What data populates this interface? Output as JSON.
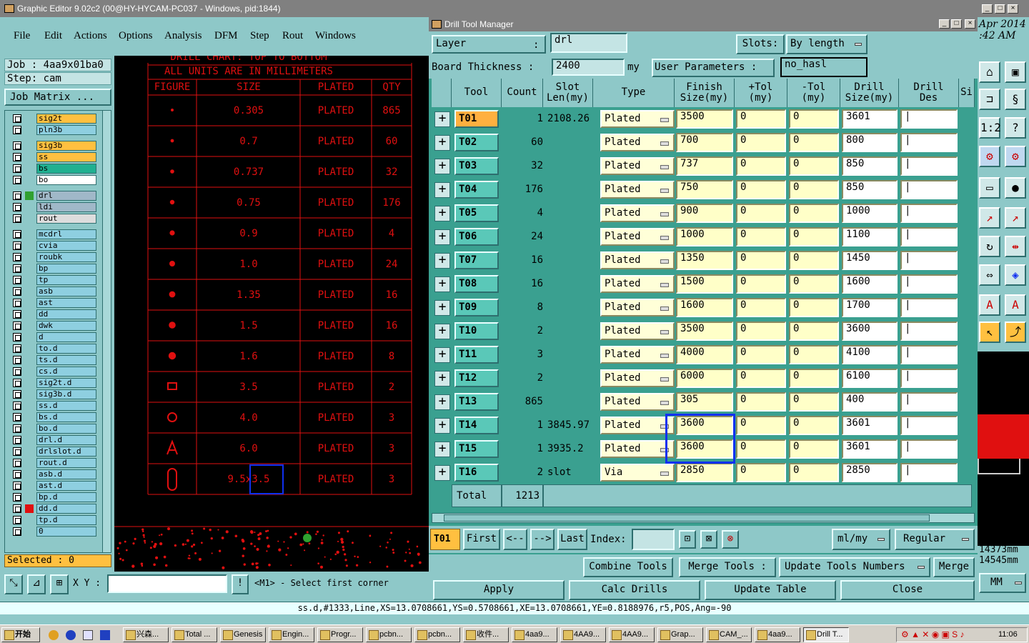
{
  "main_window": {
    "title": "Graphic Editor 9.02c2 (00@HY-HYCAM-PC037 - Windows, pid:1844)"
  },
  "menu": [
    "File",
    "Edit",
    "Actions",
    "Options",
    "Analysis",
    "DFM",
    "Step",
    "Rout",
    "Windows"
  ],
  "job": {
    "job_label": "Job : 4aa9x01ba0",
    "step_label": "Step: cam",
    "matrix_button": "Job Matrix ..."
  },
  "layers": [
    {
      "name": "sig2t",
      "color": "#ffc040"
    },
    {
      "name": "pln3b",
      "color": "#8ecfe0"
    },
    {
      "name": "sig3b",
      "color": "#ffc040"
    },
    {
      "name": "ss",
      "color": "#ffc040"
    },
    {
      "name": "bs",
      "color": "#20b090"
    },
    {
      "name": "bo",
      "color": "#ffffff"
    },
    {
      "name": "drl",
      "color": "#a0b8c8"
    },
    {
      "name": "ldi",
      "color": "#a0b8c8"
    },
    {
      "name": "rout",
      "color": "#dddddd"
    },
    {
      "name": "mcdrl",
      "color": "#8ecfe0"
    },
    {
      "name": "cvia",
      "color": "#8ecfe0"
    },
    {
      "name": "roubk",
      "color": "#8ecfe0"
    },
    {
      "name": "bp",
      "color": "#8ecfe0"
    },
    {
      "name": "tp",
      "color": "#8ecfe0"
    },
    {
      "name": "asb",
      "color": "#8ecfe0"
    },
    {
      "name": "ast",
      "color": "#8ecfe0"
    },
    {
      "name": "dd",
      "color": "#8ecfe0"
    },
    {
      "name": "dwk",
      "color": "#8ecfe0"
    },
    {
      "name": "d",
      "color": "#8ecfe0"
    },
    {
      "name": "to.d",
      "color": "#8ecfe0"
    },
    {
      "name": "ts.d",
      "color": "#8ecfe0"
    },
    {
      "name": "cs.d",
      "color": "#8ecfe0"
    },
    {
      "name": "sig2t.d",
      "color": "#8ecfe0"
    },
    {
      "name": "sig3b.d",
      "color": "#8ecfe0"
    },
    {
      "name": "ss.d",
      "color": "#8ecfe0"
    },
    {
      "name": "bs.d",
      "color": "#8ecfe0"
    },
    {
      "name": "bo.d",
      "color": "#8ecfe0"
    },
    {
      "name": "drl.d",
      "color": "#8ecfe0"
    },
    {
      "name": "drlslot.d",
      "color": "#8ecfe0"
    },
    {
      "name": "rout.d",
      "color": "#8ecfe0"
    },
    {
      "name": "asb.d",
      "color": "#8ecfe0"
    },
    {
      "name": "ast.d",
      "color": "#8ecfe0"
    },
    {
      "name": "bp.d",
      "color": "#8ecfe0"
    },
    {
      "name": "dd.d",
      "color": "#8ecfe0"
    },
    {
      "name": "tp.d",
      "color": "#8ecfe0"
    },
    {
      "name": "0",
      "color": "#8ecfe0"
    }
  ],
  "selected_label": "Selected : 0",
  "xy_label": "X Y :",
  "prompt": "<M1> - Select first corner",
  "drill_chart": {
    "header1": "DRILL CHART: TOP TO BOTTOM",
    "header2": "ALL UNITS ARE IN MILLIMETERS",
    "columns": [
      "FIGURE",
      "SIZE",
      "PLATED",
      "QTY"
    ],
    "rows": [
      {
        "size": "0.305",
        "plated": "PLATED",
        "qty": "865"
      },
      {
        "size": "0.7",
        "plated": "PLATED",
        "qty": "60"
      },
      {
        "size": "0.737",
        "plated": "PLATED",
        "qty": "32"
      },
      {
        "size": "0.75",
        "plated": "PLATED",
        "qty": "176"
      },
      {
        "size": "0.9",
        "plated": "PLATED",
        "qty": "4"
      },
      {
        "size": "1.0",
        "plated": "PLATED",
        "qty": "24"
      },
      {
        "size": "1.35",
        "plated": "PLATED",
        "qty": "16"
      },
      {
        "size": "1.5",
        "plated": "PLATED",
        "qty": "16"
      },
      {
        "size": "1.6",
        "plated": "PLATED",
        "qty": "8"
      },
      {
        "size": "3.5",
        "plated": "PLATED",
        "qty": "2"
      },
      {
        "size": "4.0",
        "plated": "PLATED",
        "qty": "3"
      },
      {
        "size": "6.0",
        "plated": "PLATED",
        "qty": "3"
      },
      {
        "size": "9.5x3.5",
        "plated": "PLATED",
        "qty": "3"
      }
    ]
  },
  "dtm": {
    "title": "Drill Tool Manager",
    "layer_label": "Layer",
    "layer_colon": ":",
    "layer_value": "drl",
    "slots_label": "Slots:",
    "slots_value": "By length",
    "thickness_label": "Board Thickness :",
    "thickness_value": "2400",
    "thickness_unit": "my",
    "user_params_label": "User Parameters :",
    "user_params_value": "no_hasl",
    "columns": {
      "tool": "Tool",
      "count": "Count",
      "slot1": "Slot",
      "slot2": "Len(my)",
      "type": "Type",
      "finish1": "Finish",
      "finish2": "Size(my)",
      "ptol1": "+Tol",
      "ptol2": "(my)",
      "mtol1": "-Tol",
      "mtol2": "(my)",
      "drill1": "Drill",
      "drill2": "Size(my)",
      "des1": "Drill",
      "des2": "Des",
      "si": "Si"
    },
    "tools": [
      {
        "tool": "T01",
        "count": "1",
        "slot": "2108.26",
        "type": "Plated",
        "finish": "3500",
        "ptol": "0",
        "mtol": "0",
        "drill": "3601"
      },
      {
        "tool": "T02",
        "count": "60",
        "slot": "",
        "type": "Plated",
        "finish": "700",
        "ptol": "0",
        "mtol": "0",
        "drill": "800"
      },
      {
        "tool": "T03",
        "count": "32",
        "slot": "",
        "type": "Plated",
        "finish": "737",
        "ptol": "0",
        "mtol": "0",
        "drill": "850"
      },
      {
        "tool": "T04",
        "count": "176",
        "slot": "",
        "type": "Plated",
        "finish": "750",
        "ptol": "0",
        "mtol": "0",
        "drill": "850"
      },
      {
        "tool": "T05",
        "count": "4",
        "slot": "",
        "type": "Plated",
        "finish": "900",
        "ptol": "0",
        "mtol": "0",
        "drill": "1000"
      },
      {
        "tool": "T06",
        "count": "24",
        "slot": "",
        "type": "Plated",
        "finish": "1000",
        "ptol": "0",
        "mtol": "0",
        "drill": "1100"
      },
      {
        "tool": "T07",
        "count": "16",
        "slot": "",
        "type": "Plated",
        "finish": "1350",
        "ptol": "0",
        "mtol": "0",
        "drill": "1450"
      },
      {
        "tool": "T08",
        "count": "16",
        "slot": "",
        "type": "Plated",
        "finish": "1500",
        "ptol": "0",
        "mtol": "0",
        "drill": "1600"
      },
      {
        "tool": "T09",
        "count": "8",
        "slot": "",
        "type": "Plated",
        "finish": "1600",
        "ptol": "0",
        "mtol": "0",
        "drill": "1700"
      },
      {
        "tool": "T10",
        "count": "2",
        "slot": "",
        "type": "Plated",
        "finish": "3500",
        "ptol": "0",
        "mtol": "0",
        "drill": "3600"
      },
      {
        "tool": "T11",
        "count": "3",
        "slot": "",
        "type": "Plated",
        "finish": "4000",
        "ptol": "0",
        "mtol": "0",
        "drill": "4100"
      },
      {
        "tool": "T12",
        "count": "2",
        "slot": "",
        "type": "Plated",
        "finish": "6000",
        "ptol": "0",
        "mtol": "0",
        "drill": "6100"
      },
      {
        "tool": "T13",
        "count": "865",
        "slot": "",
        "type": "Plated",
        "finish": "305",
        "ptol": "0",
        "mtol": "0",
        "drill": "400"
      },
      {
        "tool": "T14",
        "count": "1",
        "slot": "3845.97",
        "type": "Plated",
        "finish": "3600",
        "ptol": "0",
        "mtol": "0",
        "drill": "3601"
      },
      {
        "tool": "T15",
        "count": "1",
        "slot": "3935.2",
        "type": "Plated",
        "finish": "3600",
        "ptol": "0",
        "mtol": "0",
        "drill": "3601"
      },
      {
        "tool": "T16",
        "count": "2",
        "slot": "slot",
        "type": "Via",
        "finish": "2850",
        "ptol": "0",
        "mtol": "0",
        "drill": "2850"
      }
    ],
    "total_label": "Total",
    "total_value": "1213",
    "nav": {
      "current": "T01",
      "first": "First",
      "prev": "<--",
      "next": "-->",
      "last": "Last",
      "index": "Index:",
      "units": "ml/my",
      "mode": "Regular"
    },
    "actions": {
      "combine": "Combine Tools",
      "merge_tools": "Merge Tools :",
      "update_numbers": "Update Tools Numbers",
      "merge": "Merge"
    },
    "bottom": {
      "apply": "Apply",
      "calc": "Calc Drills",
      "update_table": "Update Table",
      "close": "Close"
    }
  },
  "right_panel": {
    "date1": "Apr 2014",
    "date2": ":42 AM",
    "coord1": "14373mm",
    "coord2": "14545mm",
    "units": "MM"
  },
  "status_line": "ss.d,#1333,Line,XS=13.0708661,YS=0.5708661,XE=13.0708661,YE=0.8188976,r5,POS,Ang=-90",
  "taskbar": {
    "start": "开始",
    "tasks": [
      "兴森...",
      "Total ...",
      "Genesis",
      "Engin...",
      "Progr...",
      "pcbn...",
      "pcbn...",
      "收件...",
      "4aa9...",
      "4AA9...",
      "4AA9...",
      "Grap...",
      "CAM_...",
      "4aa9...",
      "Drill T..."
    ],
    "clock": "11:06"
  }
}
